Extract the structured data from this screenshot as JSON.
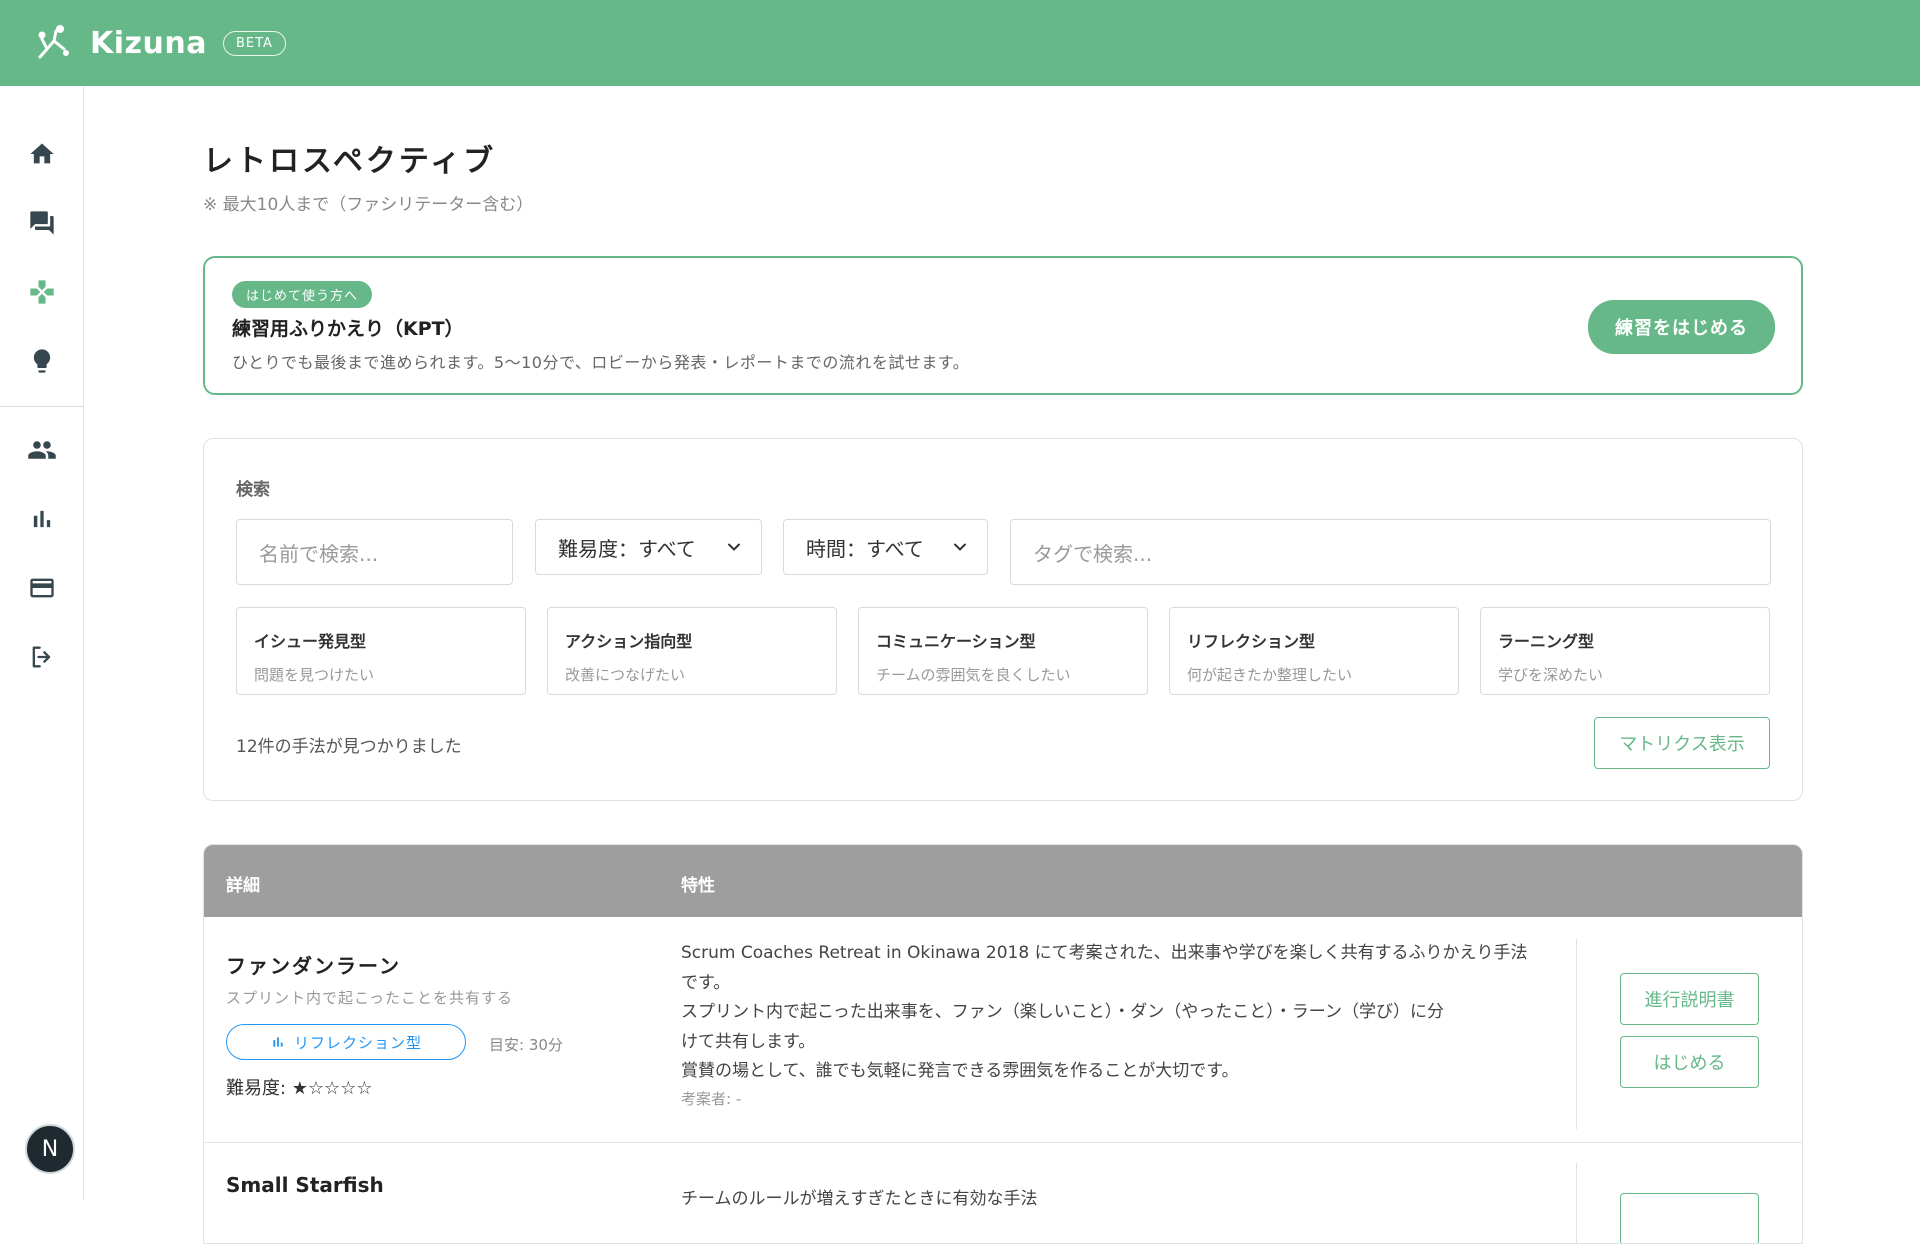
{
  "header": {
    "brand": "Kizuna",
    "beta_label": "BETA",
    "logo_icon": "kizuna-logo-icon",
    "background": "#66b888"
  },
  "sidebar": {
    "primary_icons": [
      "home-icon",
      "forum-icon",
      "gamepad-icon",
      "lightbulb-icon"
    ],
    "secondary_icons": [
      "people-icon",
      "bar-chart-icon",
      "credit-card-icon",
      "logout-icon"
    ],
    "avatar_letter": "N"
  },
  "page": {
    "title": "レトロスペクティブ",
    "note": "※ 最大10人まで（ファシリテーター含む）"
  },
  "practice": {
    "badge": "はじめて使う方へ",
    "title": "練習用ふりかえり（KPT）",
    "description": "ひとりでも最後まで進められます。5〜10分で、ロビーから発表・レポートまでの流れを試せます。",
    "button": "練習をはじめる"
  },
  "search": {
    "label": "検索",
    "name_placeholder": "名前で検索...",
    "difficulty_select": "難易度：すべて",
    "time_select": "時間：すべて",
    "tag_placeholder": "タグで検索...",
    "categories": [
      {
        "title": "イシュー発見型",
        "subtitle": "問題を見つけたい"
      },
      {
        "title": "アクション指向型",
        "subtitle": "改善につなげたい"
      },
      {
        "title": "コミュニケーション型",
        "subtitle": "チームの雰囲気を良くしたい"
      },
      {
        "title": "リフレクション型",
        "subtitle": "何が起きたか整理したい"
      },
      {
        "title": "ラーニング型",
        "subtitle": "学びを深めたい"
      }
    ],
    "result_count": "12件の手法が見つかりました",
    "matrix_button": "マトリクス表示"
  },
  "table": {
    "headers": {
      "detail": "詳細",
      "traits": "特性"
    },
    "rows": [
      {
        "title": "ファンダンラーン",
        "subtitle": "スプリント内で起こったことを共有する",
        "tag": "リフレクション型",
        "tag_icon": "bar-chart-icon",
        "time": "目安: 30分",
        "difficulty": "難易度: ★☆☆☆☆",
        "description_lines": [
          "Scrum Coaches Retreat in Okinawa 2018 にて考案された、出来事や学びを楽しく共有するふりかえり手法",
          "です。",
          "スプリント内で起こった出来事を、ファン（楽しいこと）・ダン（やったこと）・ラーン（学び）に分",
          "けて共有します。",
          "賞賛の場として、誰でも気軽に発言できる雰囲気を作ることが大切です。"
        ],
        "author": "考案者: -",
        "guide_button": "進行説明書",
        "start_button": "はじめる"
      },
      {
        "title": "Small Starfish",
        "description_lines": [
          "チームのルールが増えすぎたときに有効な手法"
        ]
      }
    ]
  }
}
